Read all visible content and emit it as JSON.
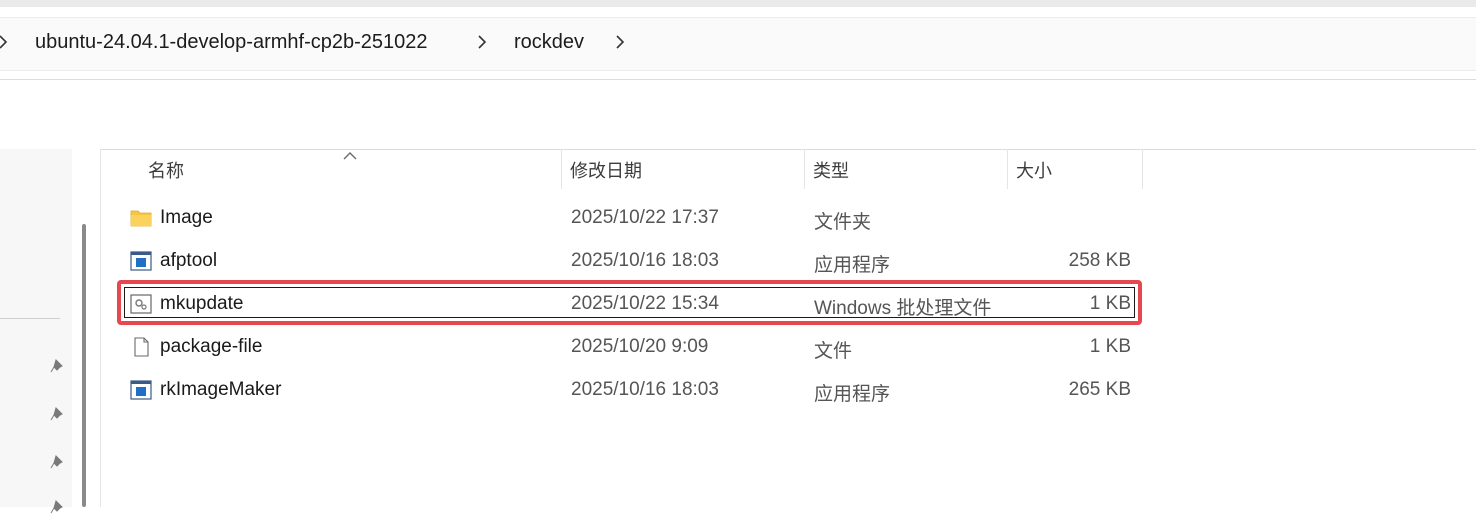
{
  "breadcrumb": {
    "items": [
      {
        "label": "ubuntu-24.04.1-develop-armhf-cp2b-251022"
      },
      {
        "label": "rockdev"
      }
    ]
  },
  "columns": {
    "name": "名称",
    "date": "修改日期",
    "type": "类型",
    "size": "大小"
  },
  "files": [
    {
      "name": "Image",
      "date": "2025/10/22 17:37",
      "type": "文件夹",
      "size": "",
      "icon": "folder-icon"
    },
    {
      "name": "afptool",
      "date": "2025/10/16 18:03",
      "type": "应用程序",
      "size": "258 KB",
      "icon": "application-icon"
    },
    {
      "name": "mkupdate",
      "date": "2025/10/22 15:34",
      "type": "Windows 批处理文件",
      "size": "1 KB",
      "icon": "batch-file-icon"
    },
    {
      "name": "package-file",
      "date": "2025/10/20 9:09",
      "type": "文件",
      "size": "1 KB",
      "icon": "file-icon"
    },
    {
      "name": "rkImageMaker",
      "date": "2025/10/16 18:03",
      "type": "应用程序",
      "size": "265 KB",
      "icon": "application-icon"
    }
  ],
  "colors": {
    "highlight": "#e8474f",
    "folder": "#f8c542",
    "app_blue": "#1f6fc5"
  }
}
